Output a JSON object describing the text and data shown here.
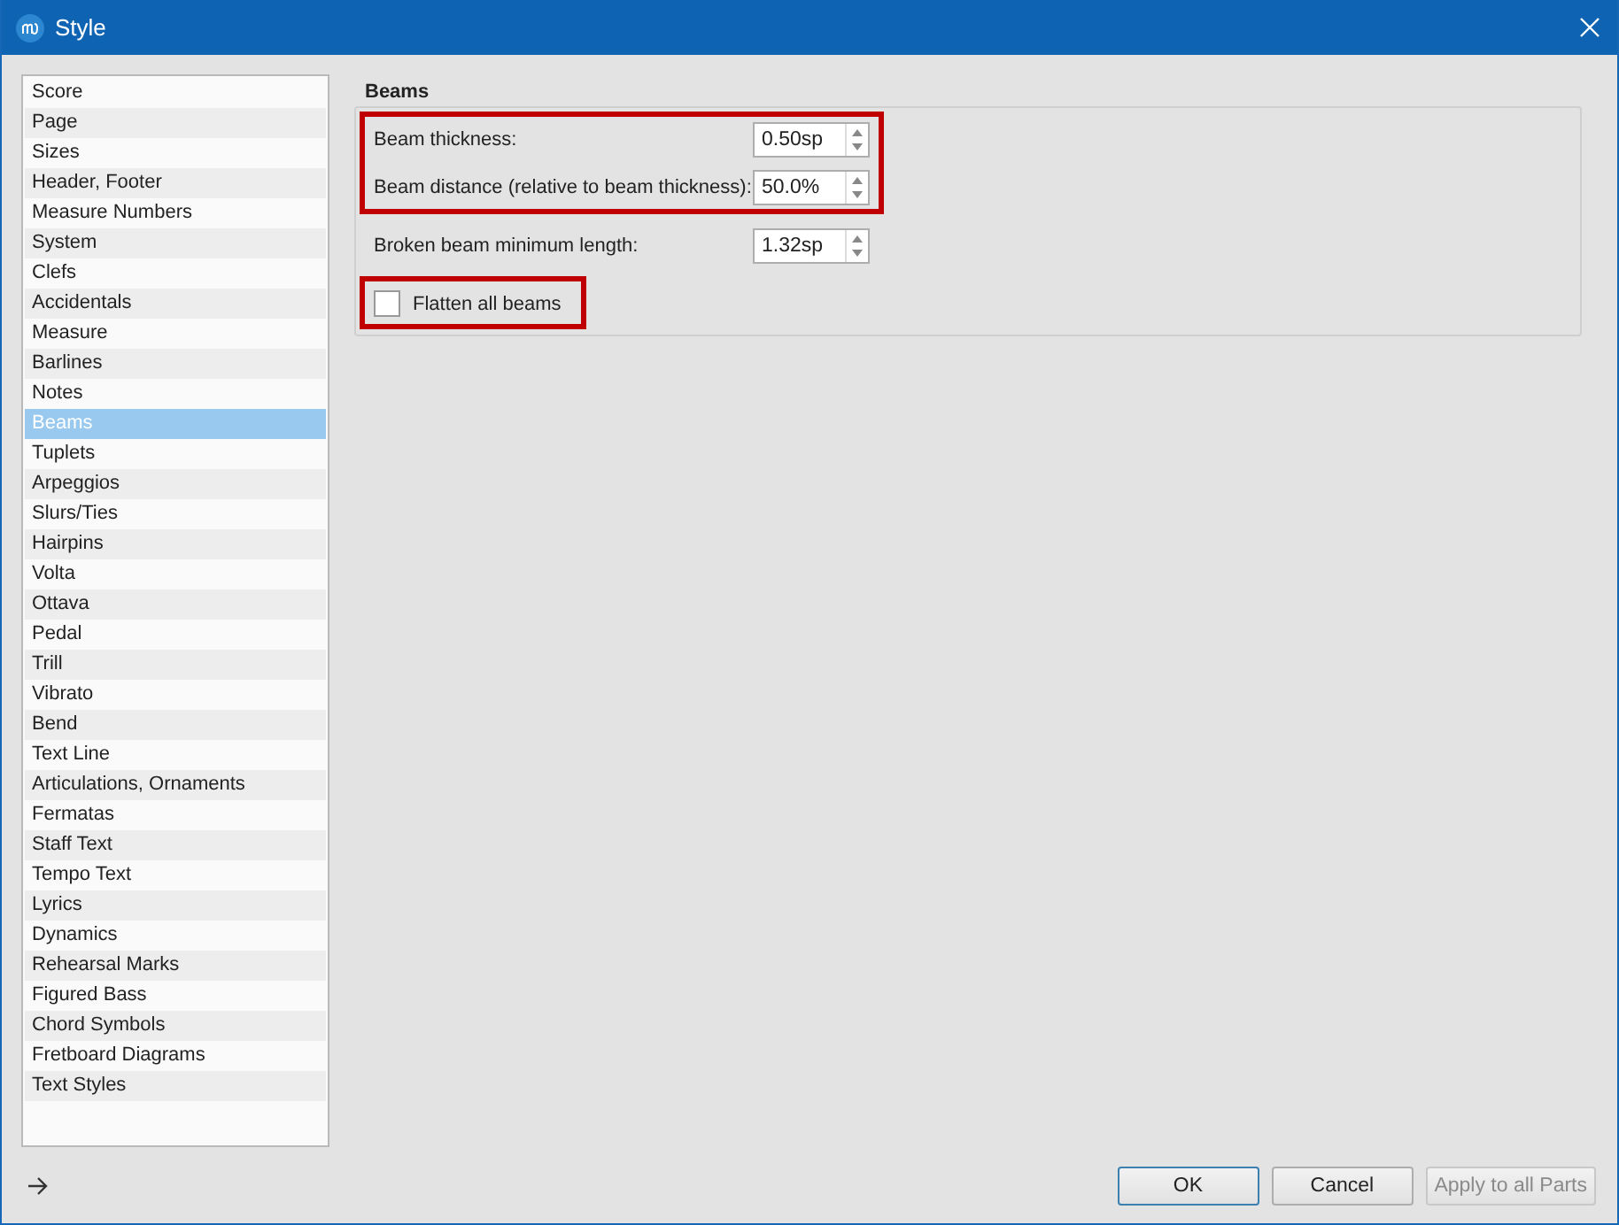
{
  "window": {
    "title": "Style"
  },
  "sidebar": {
    "items": [
      {
        "label": "Score",
        "selected": false
      },
      {
        "label": "Page",
        "selected": false
      },
      {
        "label": "Sizes",
        "selected": false
      },
      {
        "label": "Header, Footer",
        "selected": false
      },
      {
        "label": "Measure Numbers",
        "selected": false
      },
      {
        "label": "System",
        "selected": false
      },
      {
        "label": "Clefs",
        "selected": false
      },
      {
        "label": "Accidentals",
        "selected": false
      },
      {
        "label": "Measure",
        "selected": false
      },
      {
        "label": "Barlines",
        "selected": false
      },
      {
        "label": "Notes",
        "selected": false
      },
      {
        "label": "Beams",
        "selected": true
      },
      {
        "label": "Tuplets",
        "selected": false
      },
      {
        "label": "Arpeggios",
        "selected": false
      },
      {
        "label": "Slurs/Ties",
        "selected": false
      },
      {
        "label": "Hairpins",
        "selected": false
      },
      {
        "label": "Volta",
        "selected": false
      },
      {
        "label": "Ottava",
        "selected": false
      },
      {
        "label": "Pedal",
        "selected": false
      },
      {
        "label": "Trill",
        "selected": false
      },
      {
        "label": "Vibrato",
        "selected": false
      },
      {
        "label": "Bend",
        "selected": false
      },
      {
        "label": "Text Line",
        "selected": false
      },
      {
        "label": "Articulations, Ornaments",
        "selected": false
      },
      {
        "label": "Fermatas",
        "selected": false
      },
      {
        "label": "Staff Text",
        "selected": false
      },
      {
        "label": "Tempo Text",
        "selected": false
      },
      {
        "label": "Lyrics",
        "selected": false
      },
      {
        "label": "Dynamics",
        "selected": false
      },
      {
        "label": "Rehearsal Marks",
        "selected": false
      },
      {
        "label": "Figured Bass",
        "selected": false
      },
      {
        "label": "Chord Symbols",
        "selected": false
      },
      {
        "label": "Fretboard Diagrams",
        "selected": false
      },
      {
        "label": "Text Styles",
        "selected": false
      }
    ]
  },
  "panel": {
    "title": "Beams",
    "sections": [
      {
        "highlighted": true,
        "items": [
          {
            "kind": "spin",
            "label": "Beam thickness:",
            "value": "0.50sp"
          },
          {
            "kind": "spin",
            "label": "Beam distance (relative to beam thickness):",
            "value": "50.0%"
          }
        ]
      },
      {
        "highlighted": false,
        "items": [
          {
            "kind": "spin",
            "label": "Broken beam minimum length:",
            "value": "1.32sp"
          }
        ]
      },
      {
        "highlighted": true,
        "items": [
          {
            "kind": "checkbox",
            "label": "Flatten all beams",
            "checked": false
          }
        ]
      }
    ]
  },
  "buttons": [
    {
      "label": "OK",
      "default": true,
      "disabled": false
    },
    {
      "label": "Cancel",
      "default": false,
      "disabled": false
    },
    {
      "label": "Apply to all Parts",
      "default": false,
      "disabled": true
    }
  ]
}
